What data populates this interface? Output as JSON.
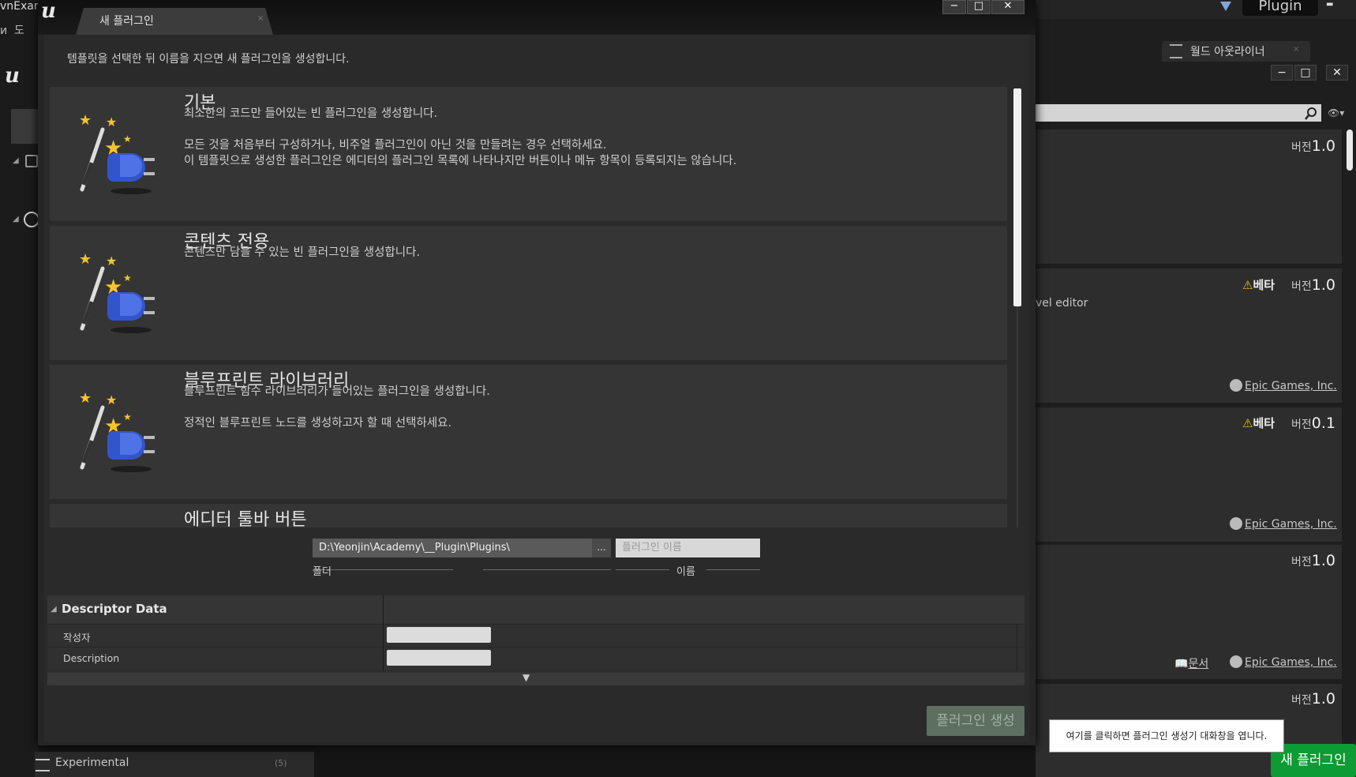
{
  "background": {
    "window_title_fragment": "vnExam",
    "menu_fragments": [
      "и",
      "도"
    ],
    "plugin_button": "Plugin",
    "outliner_tab": "월드 아웃라이너",
    "window_buttons": [
      "−",
      "□",
      "✕"
    ],
    "version_label": "버전",
    "beta_label": "베타",
    "cards": [
      {
        "version": "1.0"
      },
      {
        "version": "1.0",
        "beta": true,
        "fragment": "vel editor",
        "author": "Epic Games, Inc."
      },
      {
        "version": "0.1",
        "beta": true,
        "author": "Epic Games, Inc."
      },
      {
        "version": "1.0",
        "docs": "문서",
        "author": "Epic Games, Inc."
      },
      {
        "version": "1.0"
      }
    ],
    "experimental_label": "Experimental",
    "experimental_count": "(5)",
    "tooltip": "여기를 클릭하면 플러그인 생성기 대화창을 엽니다.",
    "new_plugin_button": "새 플러그인",
    "new_plugin_color": "#0c9b34"
  },
  "dialog": {
    "tab_title": "새 플러그인",
    "tab_close": "×",
    "window_buttons": [
      "−",
      "□",
      "✕"
    ],
    "intro": "템플릿을 선택한 뒤 이름을 지으면 새 플러그인을 생성합니다.",
    "templates": [
      {
        "title": "기본",
        "description": "최소한의 코드만 들어있는 빈 플러그인을 생성합니다.\n\n모든 것을 처음부터 구성하거나, 비주얼 플러그인이 아닌 것을 만들려는 경우 선택하세요.\n이 템플릿으로 생성한 플러그인은 에디터의 플러그인 목록에 나타나지만 버튼이나 메뉴 항목이 등록되지는 않습니다."
      },
      {
        "title": "콘텐츠 전용",
        "description": "콘텐츠만 담을 수 있는 빈 플러그인을 생성합니다."
      },
      {
        "title": "블루프린트 라이브러리",
        "description": "블루프린트 함수 라이브러리가 들어있는 플러그인을 생성합니다.\n\n정적인 블루프린트 노드를 생성하고자 할 때 선택하세요."
      },
      {
        "title": "에디터 툴바 버튼",
        "description": ""
      }
    ],
    "path_value": "D:\\Yeonjin\\Academy\\__Plugin\\Plugins\\",
    "path_browse": "...",
    "name_placeholder": "플러그인 이름",
    "folder_hint": "폴더",
    "name_hint": "이름",
    "descriptor": {
      "title": "Descriptor Data",
      "rows": [
        {
          "label": "작성자",
          "value": ""
        },
        {
          "label": "Description",
          "value": ""
        }
      ]
    },
    "create_button": "플러그인 생성"
  }
}
